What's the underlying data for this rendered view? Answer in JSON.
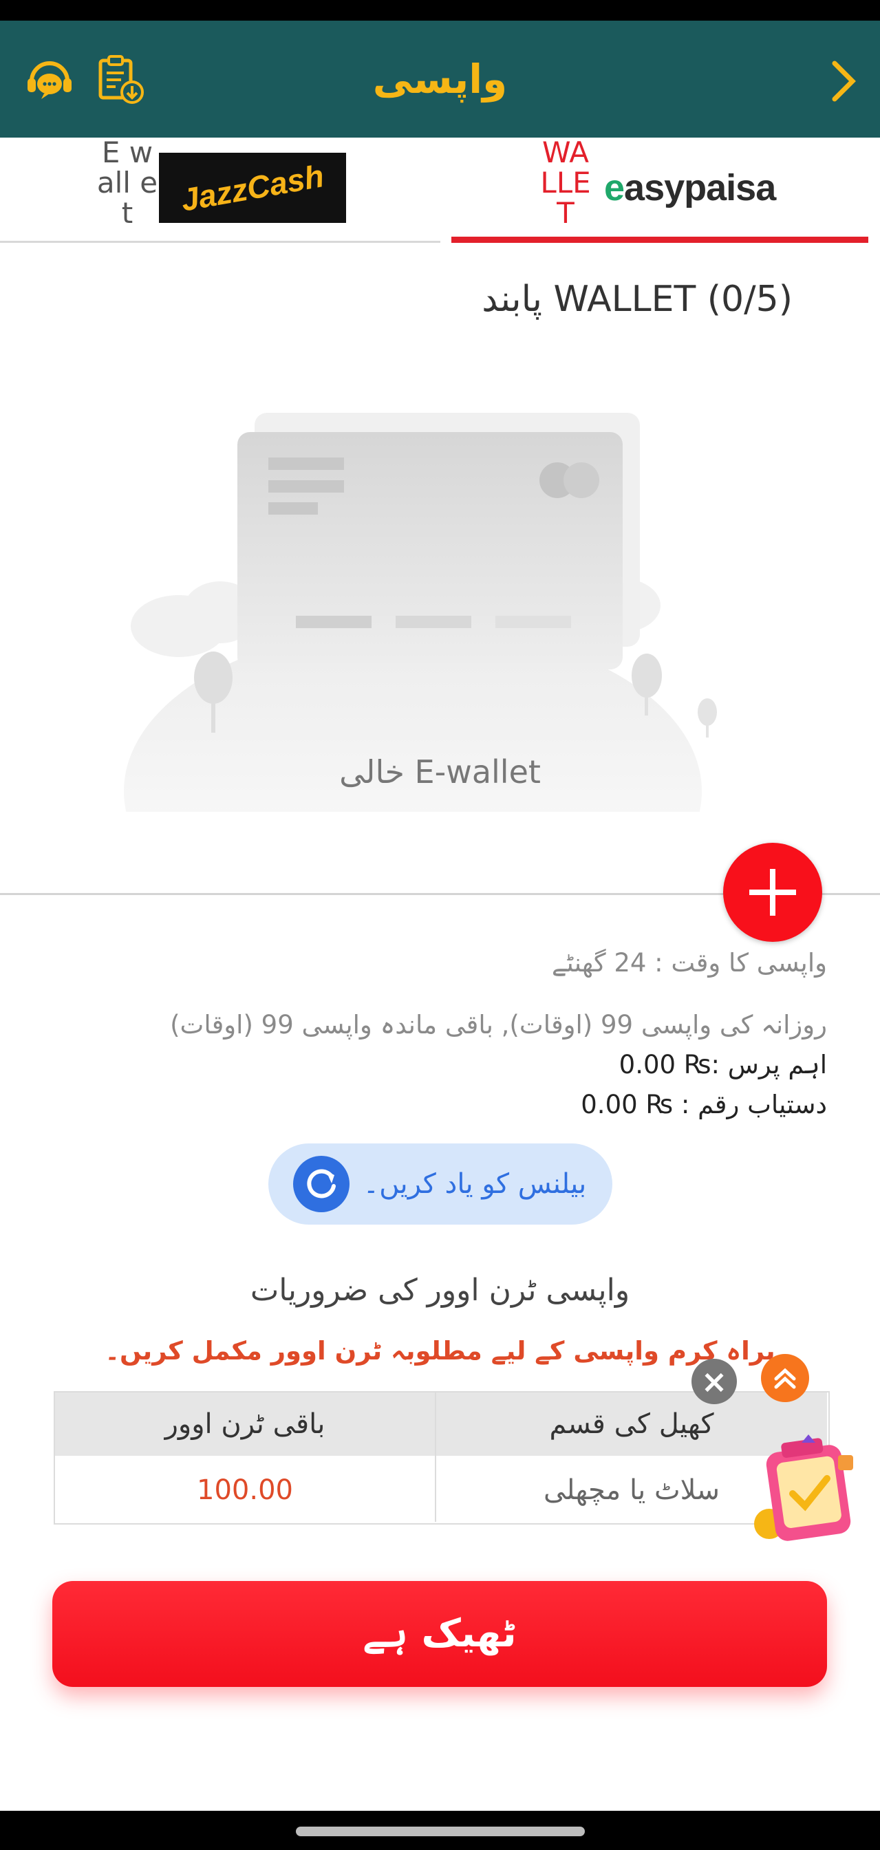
{
  "header": {
    "title": "واپسی",
    "colors": {
      "background": "#1b5a5c",
      "accent": "#f6b615"
    },
    "icons": [
      "support-chat-icon",
      "history-clipboard-icon",
      "chevron-right-icon"
    ]
  },
  "tabs": [
    {
      "label_text": "E wall et",
      "logo_text": "JazzCash",
      "selected": false
    },
    {
      "label_text": "WA LLE T",
      "logo_text": "easypaisa",
      "selected": true
    }
  ],
  "wallet": {
    "count_label": "پابند WALLET (0/5)",
    "empty_label": "خالی E-wallet"
  },
  "info": {
    "time": "واپسی کا وقت  :  24 گھنٹے",
    "daily": "روزانہ کی واپسی 99 (اوقات), باقی ماندہ واپسی 99 (اوقات)",
    "main_purse": "اہم پرس :₨ 0.00",
    "available": "دستیاب رقم : ₨ 0.00"
  },
  "remember_balance": {
    "label": "بیلنس کو یاد کریں۔"
  },
  "requirements": {
    "title": "واپسی ٹرن اوور کی ضروریات",
    "note": "براہ کرم واپسی کے لیے مطلوبہ ٹرن اوور مکمل کریں۔",
    "columns": [
      "کھیل کی قسم",
      "باقی ٹرن اوور"
    ],
    "rows": [
      {
        "game": "سلاٹ یا مچھلی",
        "remaining": "100.00"
      }
    ]
  },
  "ok_button": {
    "label": "ٹھیک ہے"
  },
  "colors": {
    "primary_red": "#f8101b",
    "link_blue": "#2f6fe0",
    "warning_orange": "#df4a28"
  }
}
